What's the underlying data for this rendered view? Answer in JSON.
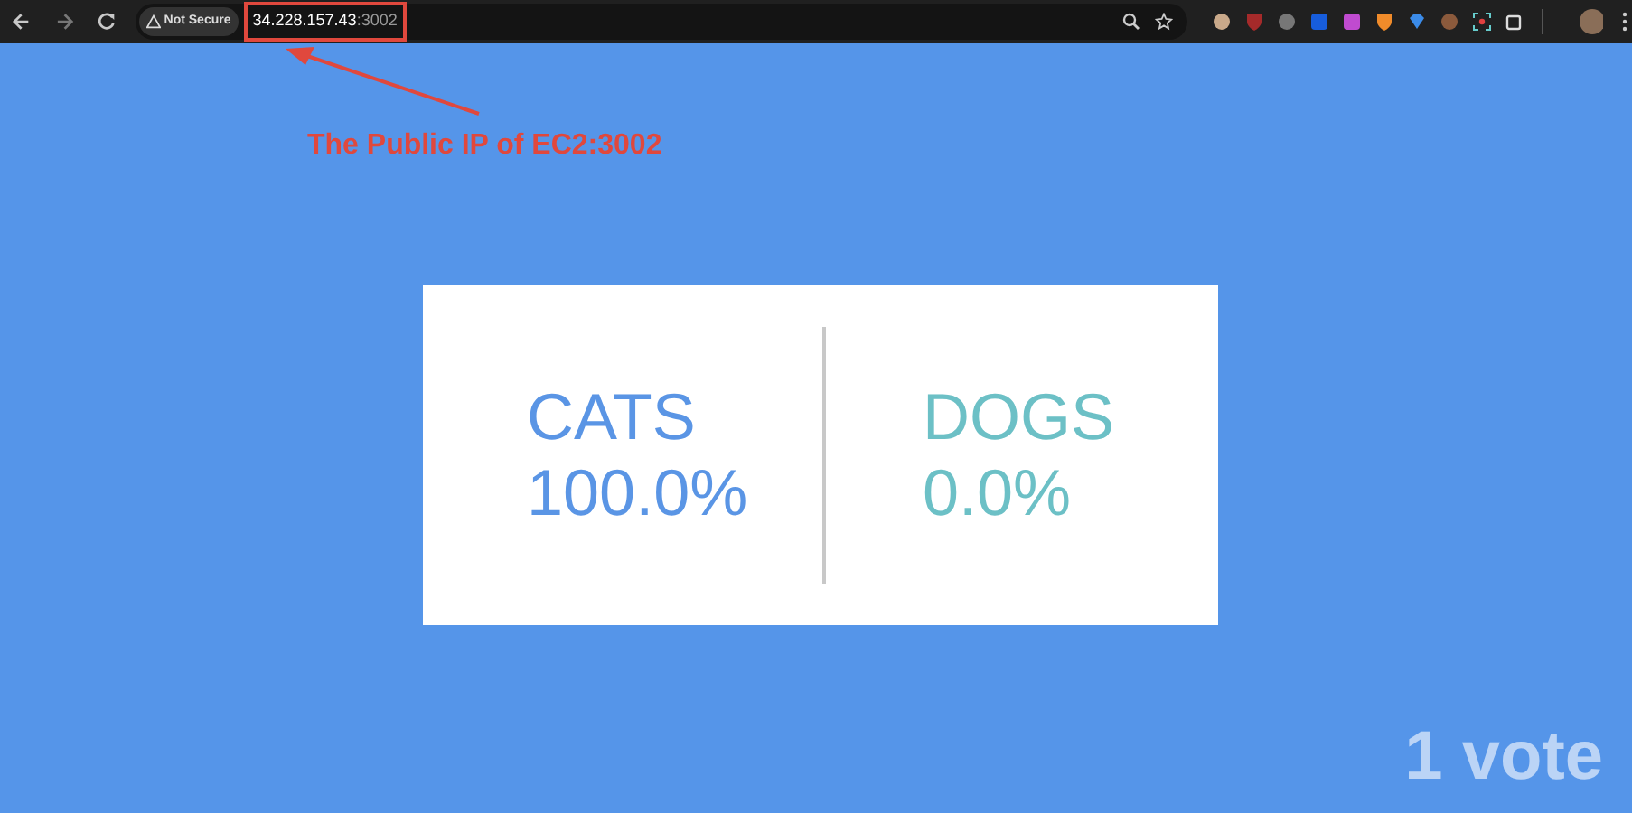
{
  "browser": {
    "security_label": "Not Secure",
    "url_host": "34.228.157.43",
    "url_port": ":3002"
  },
  "annotation": {
    "label": "The Public IP of EC2:3002"
  },
  "results": [
    {
      "option": "CATS",
      "percent": "100.0%",
      "color": "#5a95e5"
    },
    {
      "option": "DOGS",
      "percent": "0.0%",
      "color": "#6cc0c6"
    }
  ],
  "vote_count": "1 vote"
}
